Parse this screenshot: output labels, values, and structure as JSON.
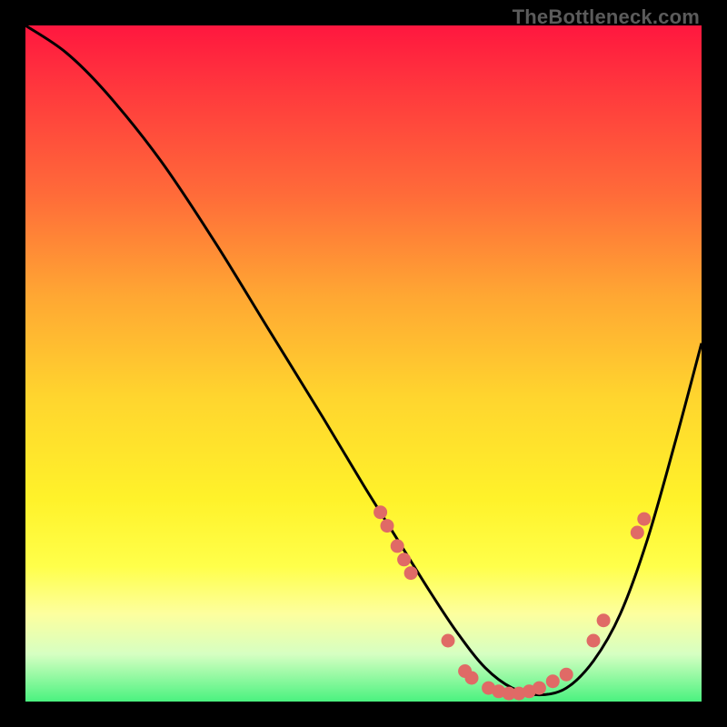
{
  "watermark": "TheBottleneck.com",
  "chart_data": {
    "type": "line",
    "title": "",
    "xlabel": "",
    "ylabel": "",
    "xlim": [
      0,
      100
    ],
    "ylim": [
      0,
      100
    ],
    "series": [
      {
        "name": "curve",
        "x": [
          0,
          6,
          12,
          20,
          28,
          36,
          44,
          50,
          55,
          60,
          64,
          68,
          72,
          76,
          80,
          84,
          88,
          92,
          96,
          100
        ],
        "y": [
          100,
          96,
          90,
          80,
          68,
          55,
          42,
          32,
          24,
          16,
          10,
          5,
          2,
          1,
          2,
          6,
          13,
          24,
          38,
          53
        ]
      }
    ],
    "markers": [
      {
        "x": 52.5,
        "y": 28
      },
      {
        "x": 53.5,
        "y": 26
      },
      {
        "x": 55.0,
        "y": 23
      },
      {
        "x": 56.0,
        "y": 21
      },
      {
        "x": 57.0,
        "y": 19
      },
      {
        "x": 62.5,
        "y": 9
      },
      {
        "x": 65.0,
        "y": 4.5
      },
      {
        "x": 66.0,
        "y": 3.5
      },
      {
        "x": 68.5,
        "y": 2
      },
      {
        "x": 70.0,
        "y": 1.5
      },
      {
        "x": 71.5,
        "y": 1.2
      },
      {
        "x": 73.0,
        "y": 1.2
      },
      {
        "x": 74.5,
        "y": 1.5
      },
      {
        "x": 76.0,
        "y": 2
      },
      {
        "x": 78.0,
        "y": 3
      },
      {
        "x": 80.0,
        "y": 4
      },
      {
        "x": 84.0,
        "y": 9
      },
      {
        "x": 85.5,
        "y": 12
      },
      {
        "x": 90.5,
        "y": 25
      },
      {
        "x": 91.5,
        "y": 27
      }
    ],
    "colors": {
      "curve": "#000000",
      "marker": "#e06a66"
    }
  }
}
